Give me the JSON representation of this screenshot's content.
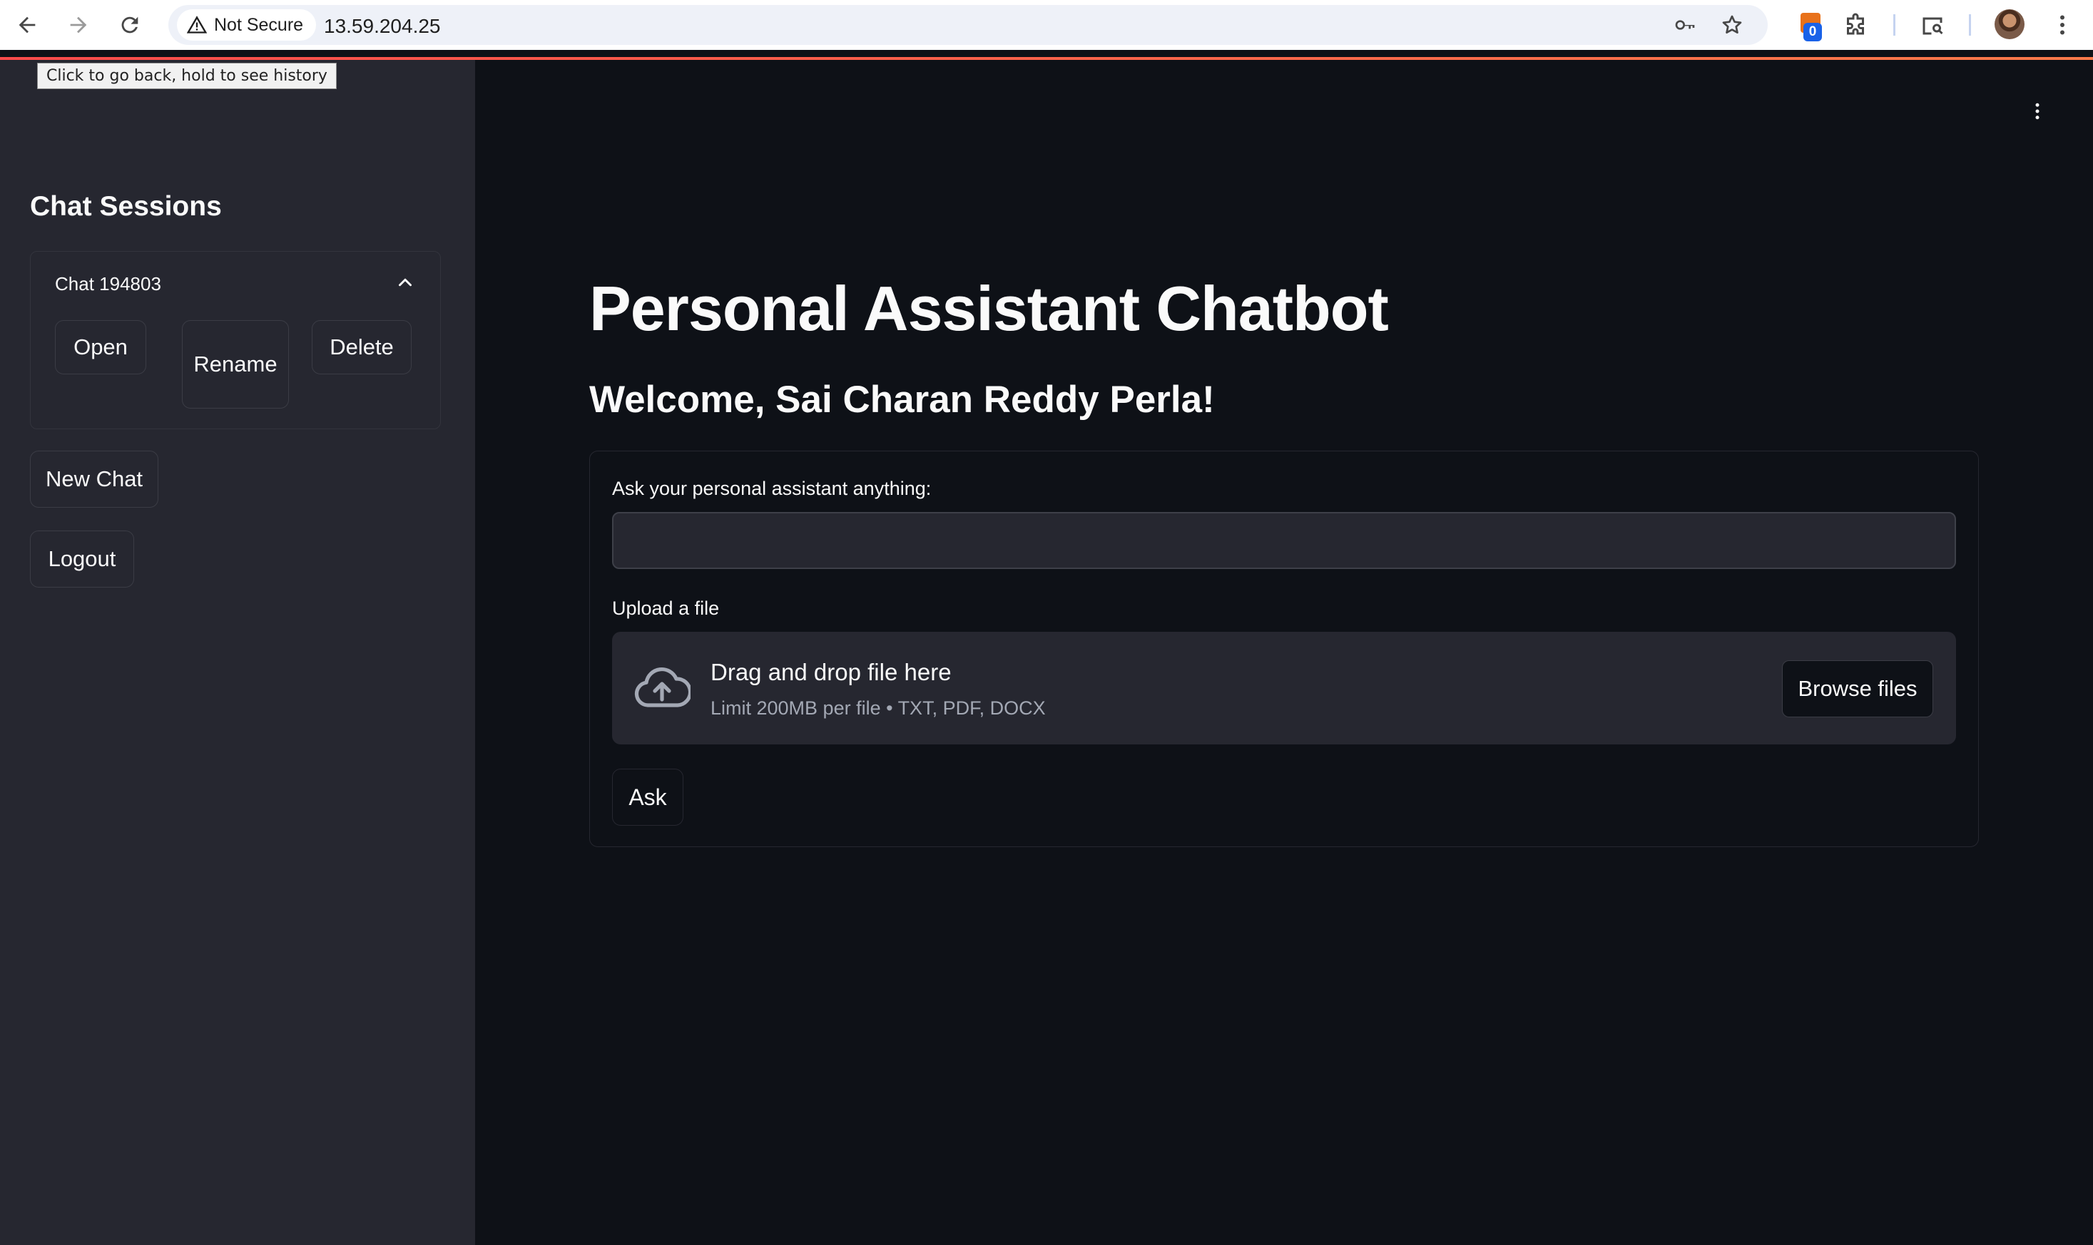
{
  "browser": {
    "security_label": "Not Secure",
    "url": "13.59.204.25",
    "extension_badge_count": "0",
    "tooltip": "Click to go back, hold to see history"
  },
  "sidebar": {
    "title": "Chat Sessions",
    "sessions": [
      {
        "title": "Chat 194803",
        "open_label": "Open",
        "rename_label": "Rename",
        "delete_label": "Delete"
      }
    ],
    "new_chat_label": "New Chat",
    "logout_label": "Logout"
  },
  "main": {
    "title": "Personal Assistant Chatbot",
    "welcome": "Welcome, Sai Charan Reddy Perla!",
    "ask_label": "Ask your personal assistant anything:",
    "ask_value": "",
    "upload_label": "Upload a file",
    "dropzone_title": "Drag and drop file here",
    "dropzone_limit": "Limit 200MB per file • TXT, PDF, DOCX",
    "browse_label": "Browse files",
    "ask_button_label": "Ask"
  },
  "colors": {
    "background": "#0e1117",
    "sidebar": "#262730",
    "accent": "#ff4b4b",
    "text": "#fafafa"
  },
  "icons": [
    "back-arrow-icon",
    "forward-arrow-icon",
    "reload-icon",
    "warning-icon",
    "key-icon",
    "star-icon",
    "extension-puzzle-icon",
    "tab-search-icon",
    "chrome-menu-icon",
    "chevron-up-icon",
    "kebab-menu-icon",
    "cloud-upload-icon"
  ]
}
